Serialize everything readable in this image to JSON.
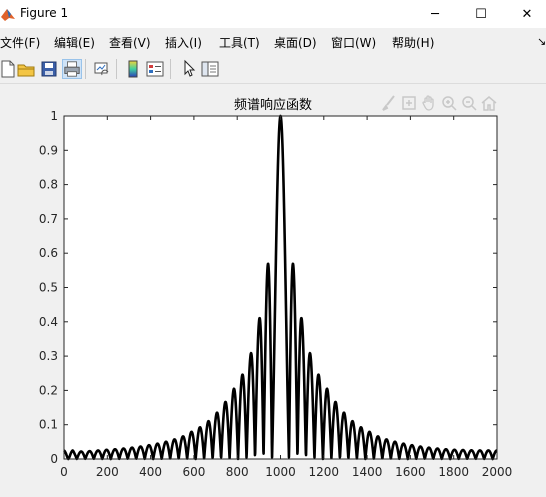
{
  "window": {
    "title": "Figure 1",
    "minimize_glyph": "─",
    "maximize_glyph": "☐",
    "close_glyph": "✕"
  },
  "menubar": {
    "items": [
      "文件(F)",
      "编辑(E)",
      "查看(V)",
      "插入(I)",
      "工具(T)",
      "桌面(D)",
      "窗口(W)",
      "帮助(H)"
    ],
    "overflow_glyph": "↘"
  },
  "toolbar": {
    "icons": [
      "new-figure-icon",
      "open-file-icon",
      "save-icon",
      "print-icon",
      "link-plot-icon",
      "colorbar-icon",
      "legend-icon",
      "edit-plot-arrow-icon",
      "property-inspector-icon"
    ]
  },
  "axes_toolbar": {
    "icons": [
      "brush-icon",
      "data-tips-icon",
      "pan-hand-icon",
      "zoom-in-icon",
      "zoom-out-icon",
      "home-icon"
    ]
  },
  "chart_data": {
    "type": "line",
    "title": "频谱响应函数",
    "xlabel": "",
    "ylabel": "",
    "xlim": [
      0,
      2000
    ],
    "ylim": [
      0,
      1
    ],
    "xticks": [
      "0",
      "200",
      "400",
      "600",
      "800",
      "1000",
      "1200",
      "1400",
      "1600",
      "1800",
      "2000"
    ],
    "yticks": [
      "0",
      "0.1",
      "0.2",
      "0.3",
      "0.4",
      "0.5",
      "0.6",
      "0.7",
      "0.8",
      "0.9",
      "1"
    ],
    "grid": false,
    "series": [
      {
        "color": "#000000",
        "description": "abs(sinc) response, peak 1 at x=1000, zeros every ~39 units",
        "x": [
          0,
          10,
          20,
          30,
          40,
          50,
          60,
          80,
          100,
          120,
          140,
          160,
          180,
          200,
          250,
          300,
          350,
          400,
          450,
          500,
          550,
          600,
          650,
          700,
          750,
          800,
          820,
          840,
          860,
          880,
          900,
          920,
          940,
          960,
          970,
          980,
          990,
          1000,
          1010,
          1020,
          1030,
          1040,
          1060,
          1080,
          1100,
          1120,
          1140,
          1160,
          1180,
          1200,
          1250,
          1300,
          1350,
          1400,
          1450,
          1500,
          1550,
          1600,
          1650,
          1700,
          1750,
          1800,
          1850,
          1900,
          1950,
          2000
        ],
        "y": [
          0.025,
          0.02,
          0.01,
          0.02,
          0.025,
          0.02,
          0.02,
          0.022,
          0.022,
          0.023,
          0.024,
          0.025,
          0.026,
          0.027,
          0.029,
          0.032,
          0.036,
          0.041,
          0.047,
          0.055,
          0.066,
          0.083,
          0.1,
          0.13,
          0.17,
          0.22,
          0.24,
          0.27,
          0.3,
          0.35,
          0.4,
          0.48,
          0.56,
          0.66,
          0.72,
          0.8,
          0.9,
          1.0,
          0.9,
          0.8,
          0.72,
          0.66,
          0.56,
          0.48,
          0.4,
          0.35,
          0.3,
          0.27,
          0.24,
          0.22,
          0.17,
          0.13,
          0.1,
          0.083,
          0.066,
          0.055,
          0.047,
          0.041,
          0.036,
          0.032,
          0.029,
          0.027,
          0.026,
          0.025,
          0.025,
          0.025
        ]
      }
    ]
  }
}
